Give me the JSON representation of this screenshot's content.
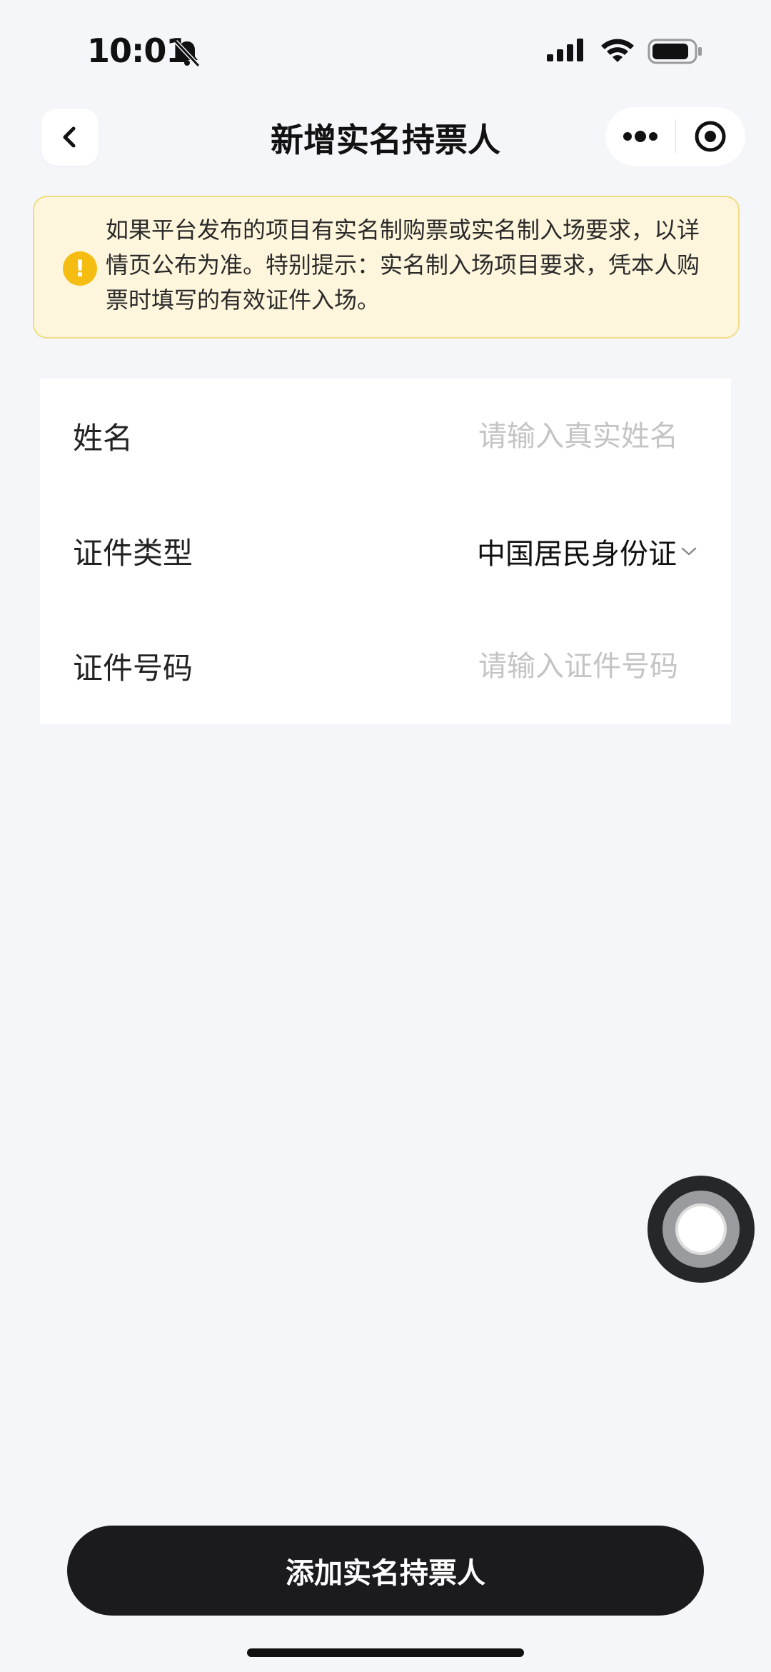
{
  "status_bar": {
    "time": "10:01",
    "icons": [
      "bell-muted-icon",
      "signal-icon",
      "wifi-icon",
      "battery-icon"
    ]
  },
  "nav": {
    "title": "新增实名持票人",
    "back_icon": "chevron-left-icon",
    "more_icon": "more-dots-icon",
    "close_icon": "target-circle-icon"
  },
  "notice": {
    "icon": "warning-icon",
    "icon_glyph": "!",
    "text": "如果平台发布的项目有实名制购票或实名制入场要求，以详情页公布为准。特别提示：实名制入场项目要求，凭本人购票时填写的有效证件入场。"
  },
  "form": {
    "name": {
      "label": "姓名",
      "placeholder": "请输入真实姓名",
      "value": ""
    },
    "id_type": {
      "label": "证件类型",
      "value": "中国居民身份证",
      "icon": "chevron-down-icon"
    },
    "id_number": {
      "label": "证件号码",
      "placeholder": "请输入证件号码",
      "value": ""
    }
  },
  "submit": {
    "label": "添加实名持票人"
  },
  "colors": {
    "background": "#f4f6fa",
    "notice_bg": "#fdf6dc",
    "notice_border": "#f1dc85",
    "warning": "#f5bd12",
    "button": "#1b1b1d"
  }
}
